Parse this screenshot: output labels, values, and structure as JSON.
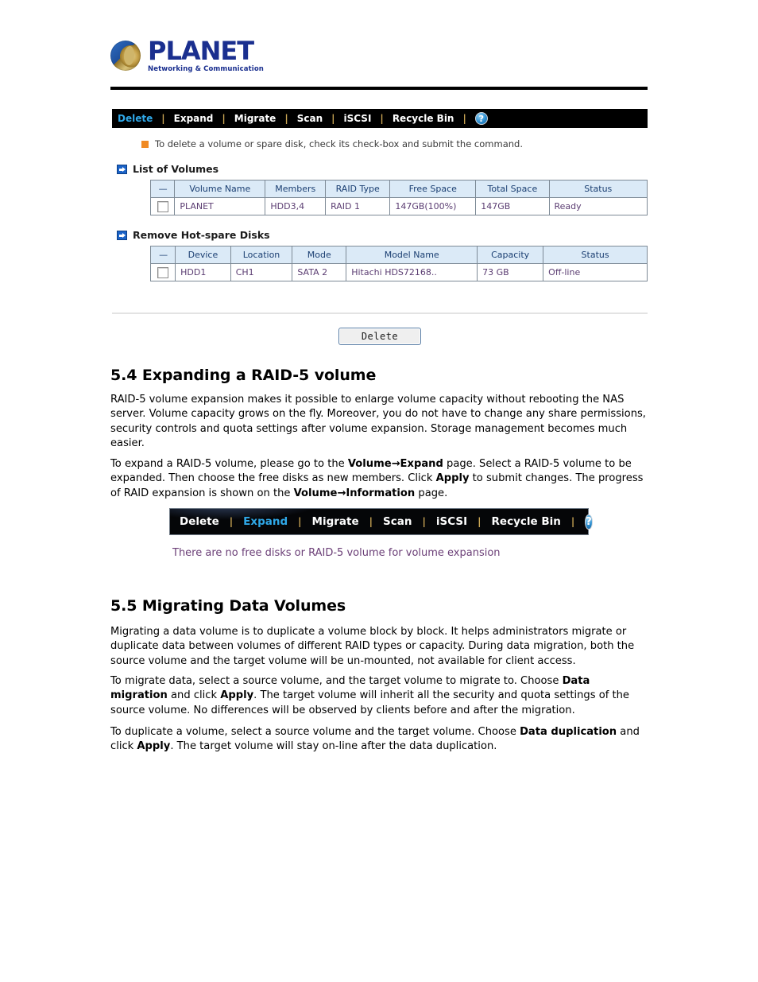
{
  "logo": {
    "word": "PLANET",
    "tagline": "Networking & Communication",
    "brand_color": "#1a2f8f"
  },
  "panel1": {
    "toolbar": {
      "items": [
        {
          "label": "Delete",
          "active": true
        },
        {
          "label": "Expand",
          "active": false
        },
        {
          "label": "Migrate",
          "active": false
        },
        {
          "label": "Scan",
          "active": false
        },
        {
          "label": "iSCSI",
          "active": false
        },
        {
          "label": "Recycle Bin",
          "active": false
        }
      ],
      "separator": "|",
      "help_icon_glyph": "?",
      "active_color": "#2fa8e8",
      "separator_color": "#d7b05a"
    },
    "note": "To delete a volume or spare disk, check its check-box and submit the command.",
    "note_bullet_color": "#f08a23",
    "volumes_section": {
      "label": "List of Volumes",
      "columns": [
        "—",
        "Volume Name",
        "Members",
        "RAID Type",
        "Free Space",
        "Total Space",
        "Status"
      ],
      "rows": [
        {
          "volume_name": "PLANET",
          "members": "HDD3,4",
          "raid_type": "RAID 1",
          "free_space": "147GB(100%)",
          "total_space": "147GB",
          "status": "Ready"
        }
      ]
    },
    "hotspare_section": {
      "label": "Remove Hot-spare Disks",
      "columns": [
        "—",
        "Device",
        "Location",
        "Mode",
        "Model Name",
        "Capacity",
        "Status"
      ],
      "rows": [
        {
          "device": "HDD1",
          "location": "CH1",
          "mode": "SATA 2",
          "model_name": "Hitachi HDS72168..",
          "capacity": "73 GB",
          "status": "Off-line"
        }
      ]
    },
    "delete_button": "Delete"
  },
  "doc": {
    "s54_heading": "5.4 Expanding a RAID-5 volume",
    "s54_p1": "RAID-5 volume expansion makes it possible to enlarge volume capacity without rebooting the NAS server. Volume capacity grows on the fly. Moreover, you do not have to change any share permissions, security controls and quota settings after volume expansion. Storage management becomes much easier.",
    "s54_p2_parts": [
      {
        "text": "To expand a RAID-5 volume, please go to the ",
        "bold": false
      },
      {
        "text": "Volume→Expand",
        "bold": true
      },
      {
        "text": " page. Select a RAID-5 volume to be expanded. Then choose the free disks as new members. Click ",
        "bold": false
      },
      {
        "text": "Apply",
        "bold": true
      },
      {
        "text": " to submit changes. The progress of RAID expansion is shown on the ",
        "bold": false
      },
      {
        "text": "Volume→Information",
        "bold": true
      },
      {
        "text": " page.",
        "bold": false
      }
    ],
    "s55_heading": "5.5 Migrating Data Volumes",
    "s55_p1": "Migrating a data volume is to duplicate a volume block by block. It helps administrators migrate or duplicate data between volumes of different RAID types or capacity. During data migration, both the source volume and the target volume will be un-mounted, not available for client access.",
    "s55_p2_parts": [
      {
        "text": "To migrate data, select a source volume, and the target volume to migrate to. Choose ",
        "bold": false
      },
      {
        "text": "Data migration",
        "bold": true
      },
      {
        "text": " and click ",
        "bold": false
      },
      {
        "text": "Apply",
        "bold": true
      },
      {
        "text": ". The target volume will inherit all the security and quota settings of the source volume. No differences will be observed by clients before and after the migration.",
        "bold": false
      }
    ],
    "s55_p3_parts": [
      {
        "text": "To duplicate a volume, select a source volume and the target volume. Choose ",
        "bold": false
      },
      {
        "text": "Data duplication",
        "bold": true
      },
      {
        "text": " and click ",
        "bold": false
      },
      {
        "text": "Apply",
        "bold": true
      },
      {
        "text": ". The target volume will stay on-line after the data duplication.",
        "bold": false
      }
    ]
  },
  "panel2": {
    "toolbar": {
      "items": [
        {
          "label": "Delete",
          "active": false
        },
        {
          "label": "Expand",
          "active": true
        },
        {
          "label": "Migrate",
          "active": false
        },
        {
          "label": "Scan",
          "active": false
        },
        {
          "label": "iSCSI",
          "active": false
        },
        {
          "label": "Recycle Bin",
          "active": false
        }
      ],
      "separator": "|",
      "help_icon_glyph": "?"
    },
    "message": "There are no free disks or RAID-5 volume for volume expansion",
    "message_color": "#6b3f77"
  }
}
